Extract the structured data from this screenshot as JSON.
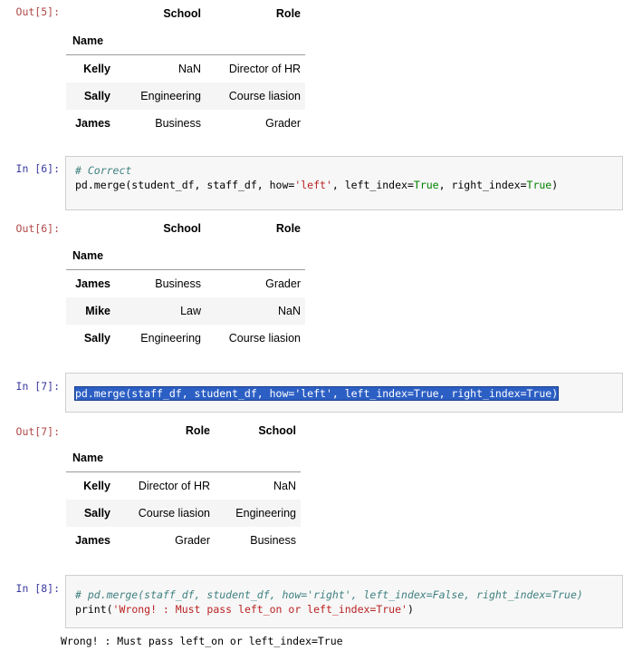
{
  "cells": {
    "out5": {
      "prompt": "Out[5]:",
      "columns": [
        "School",
        "Role"
      ],
      "index_name": "Name",
      "rows": [
        {
          "index": "Kelly",
          "values": [
            "NaN",
            "Director of HR"
          ]
        },
        {
          "index": "Sally",
          "values": [
            "Engineering",
            "Course liasion"
          ]
        },
        {
          "index": "James",
          "values": [
            "Business",
            "Grader"
          ]
        }
      ]
    },
    "in6": {
      "prompt": "In [6]:",
      "line1": "# Correct",
      "line2": {
        "a": "pd.merge(student_df, staff_df, how=",
        "b": "'left'",
        "c": ", left_index=",
        "d": "True",
        "e": ", right_index=",
        "f": "True",
        "g": ")"
      }
    },
    "out6": {
      "prompt": "Out[6]:",
      "columns": [
        "School",
        "Role"
      ],
      "index_name": "Name",
      "rows": [
        {
          "index": "James",
          "values": [
            "Business",
            "Grader"
          ]
        },
        {
          "index": "Mike",
          "values": [
            "Law",
            "NaN"
          ]
        },
        {
          "index": "Sally",
          "values": [
            "Engineering",
            "Course liasion"
          ]
        }
      ]
    },
    "in7": {
      "prompt": "In [7]:",
      "code": "pd.merge(staff_df, student_df, how='left', left_index=True, right_index=True)"
    },
    "out7": {
      "prompt": "Out[7]:",
      "columns": [
        "Role",
        "School"
      ],
      "index_name": "Name",
      "rows": [
        {
          "index": "Kelly",
          "values": [
            "Director of HR",
            "NaN"
          ]
        },
        {
          "index": "Sally",
          "values": [
            "Course liasion",
            "Engineering"
          ]
        },
        {
          "index": "James",
          "values": [
            "Grader",
            "Business"
          ]
        }
      ]
    },
    "in8": {
      "prompt": "In [8]:",
      "line1": "# pd.merge(staff_df, student_df, how='right', left_index=False, right_index=True)",
      "line2": {
        "a": "print(",
        "b": "'Wrong! : Must pass left_on or left_index=True'",
        "c": ")"
      }
    },
    "out8": {
      "stdout": "Wrong! : Must pass left_on or left_index=True"
    }
  }
}
